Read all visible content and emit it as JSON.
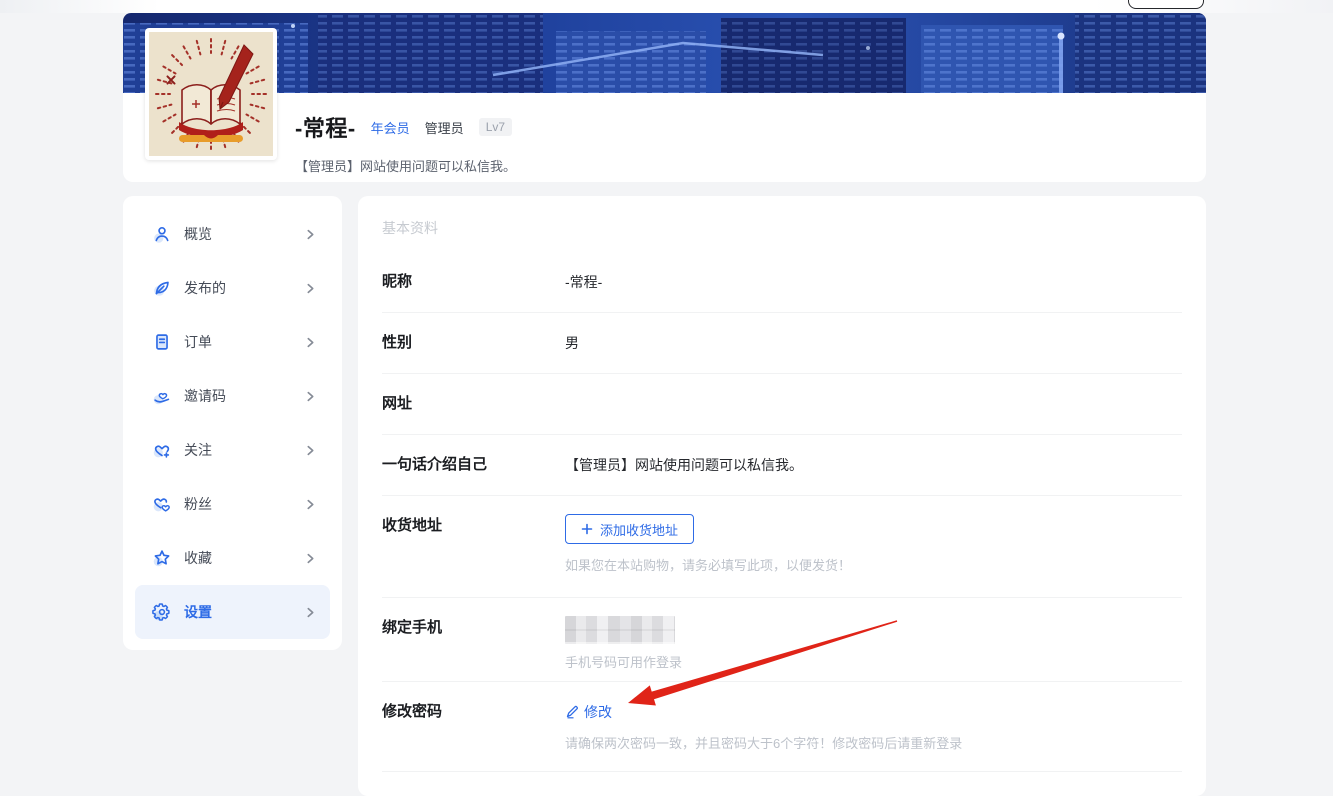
{
  "colors": {
    "accent": "#2e6be6",
    "arrow": "#e02418",
    "banner": "#1d3a8e"
  },
  "header": {
    "username": "-常程-",
    "badge_member": "年会员",
    "badge_admin": "管理员",
    "badge_level": "Lv7",
    "bio": "【管理员】网站使用问题可以私信我。"
  },
  "sidebar": {
    "items": [
      {
        "label": "概览",
        "icon": "user-icon",
        "selected": false
      },
      {
        "label": "发布的",
        "icon": "feather-icon",
        "selected": false
      },
      {
        "label": "订单",
        "icon": "order-icon",
        "selected": false
      },
      {
        "label": "邀请码",
        "icon": "invite-code-icon",
        "selected": false
      },
      {
        "label": "关注",
        "icon": "heart-plus-icon",
        "selected": false
      },
      {
        "label": "粉丝",
        "icon": "double-heart-icon",
        "selected": false
      },
      {
        "label": "收藏",
        "icon": "star-icon",
        "selected": false
      },
      {
        "label": "设置",
        "icon": "gear-icon",
        "selected": true
      }
    ]
  },
  "main": {
    "section_title": "基本资料",
    "rows": {
      "nickname": {
        "label": "昵称",
        "value": "-常程-"
      },
      "gender": {
        "label": "性别",
        "value": "男"
      },
      "website": {
        "label": "网址",
        "value": ""
      },
      "intro": {
        "label": "一句话介绍自己",
        "value": "【管理员】网站使用问题可以私信我。"
      },
      "address": {
        "label": "收货地址",
        "button": "添加收货地址",
        "hint": "如果您在本站购物，请务必填写此项，以便发货！"
      },
      "phone": {
        "label": "绑定手机",
        "hint": "手机号码可用作登录"
      },
      "password": {
        "label": "修改密码",
        "link": "修改",
        "hint": "请确保两次密码一致，并且密码大于6个字符！修改密码后请重新登录"
      }
    }
  }
}
